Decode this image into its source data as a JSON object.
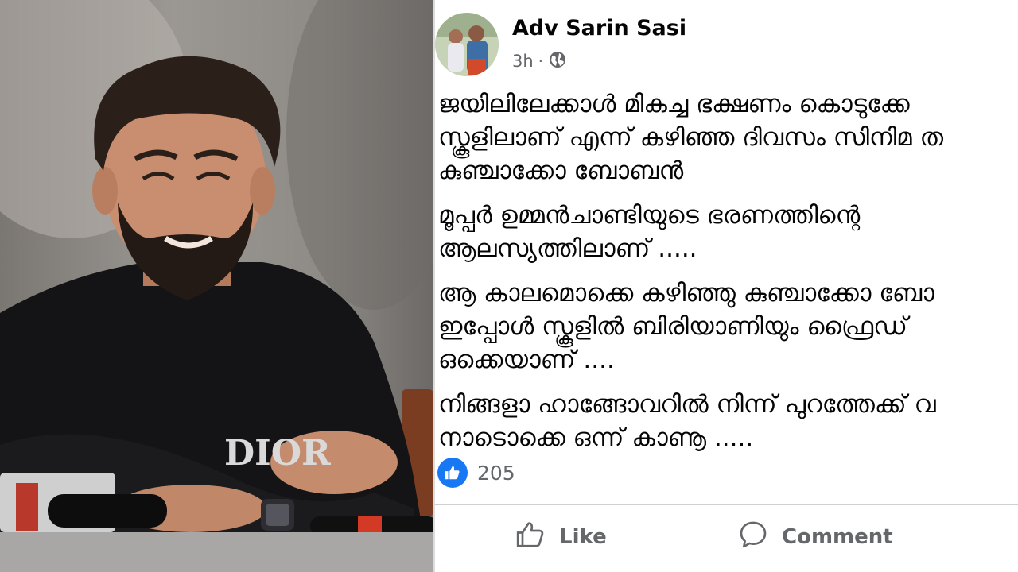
{
  "post": {
    "author": "Adv Sarin Sasi",
    "time": "3h",
    "separator": "·",
    "audience_icon": "globe-icon",
    "paragraphs": [
      "ജയിലിലേക്കാൾ മികച്ച ഭക്ഷണം കൊടുക്കേ",
      "സ്കൂളിലാണ് എന്ന് കഴിഞ്ഞ ദിവസം സിനിമ ത",
      "കുഞ്ചാക്കോ ബോബൻ",
      "മൂപ്പർ ഉമ്മൻചാണ്ടിയുടെ ഭരണത്തിന്റെ",
      "ആലസ്യത്തിലാണ് .....",
      "ആ കാലമൊക്കെ കഴിഞ്ഞു കുഞ്ചാക്കോ ബോ",
      "ഇപ്പോൾ സ്കൂളിൽ ബിരിയാണിയും ഫ്രൈഡ് ",
      "ഒക്കെയാണ് ....",
      "നിങ്ങളാ ഹാങ്ങോവറിൽ നിന്ന് പുറത്തേക്ക് വ",
      "നാടൊക്കെ ഒന്ന് കാണൂ ....."
    ],
    "reaction_count": "205",
    "reaction_icon": "like-icon",
    "actions": {
      "like_label": "Like",
      "comment_label": "Comment"
    }
  },
  "photo": {
    "shirt_text": "DIOR"
  },
  "colors": {
    "facebook_blue": "#1877f2",
    "text_primary": "#050505",
    "text_secondary": "#65676b",
    "divider": "#ced0d4"
  }
}
